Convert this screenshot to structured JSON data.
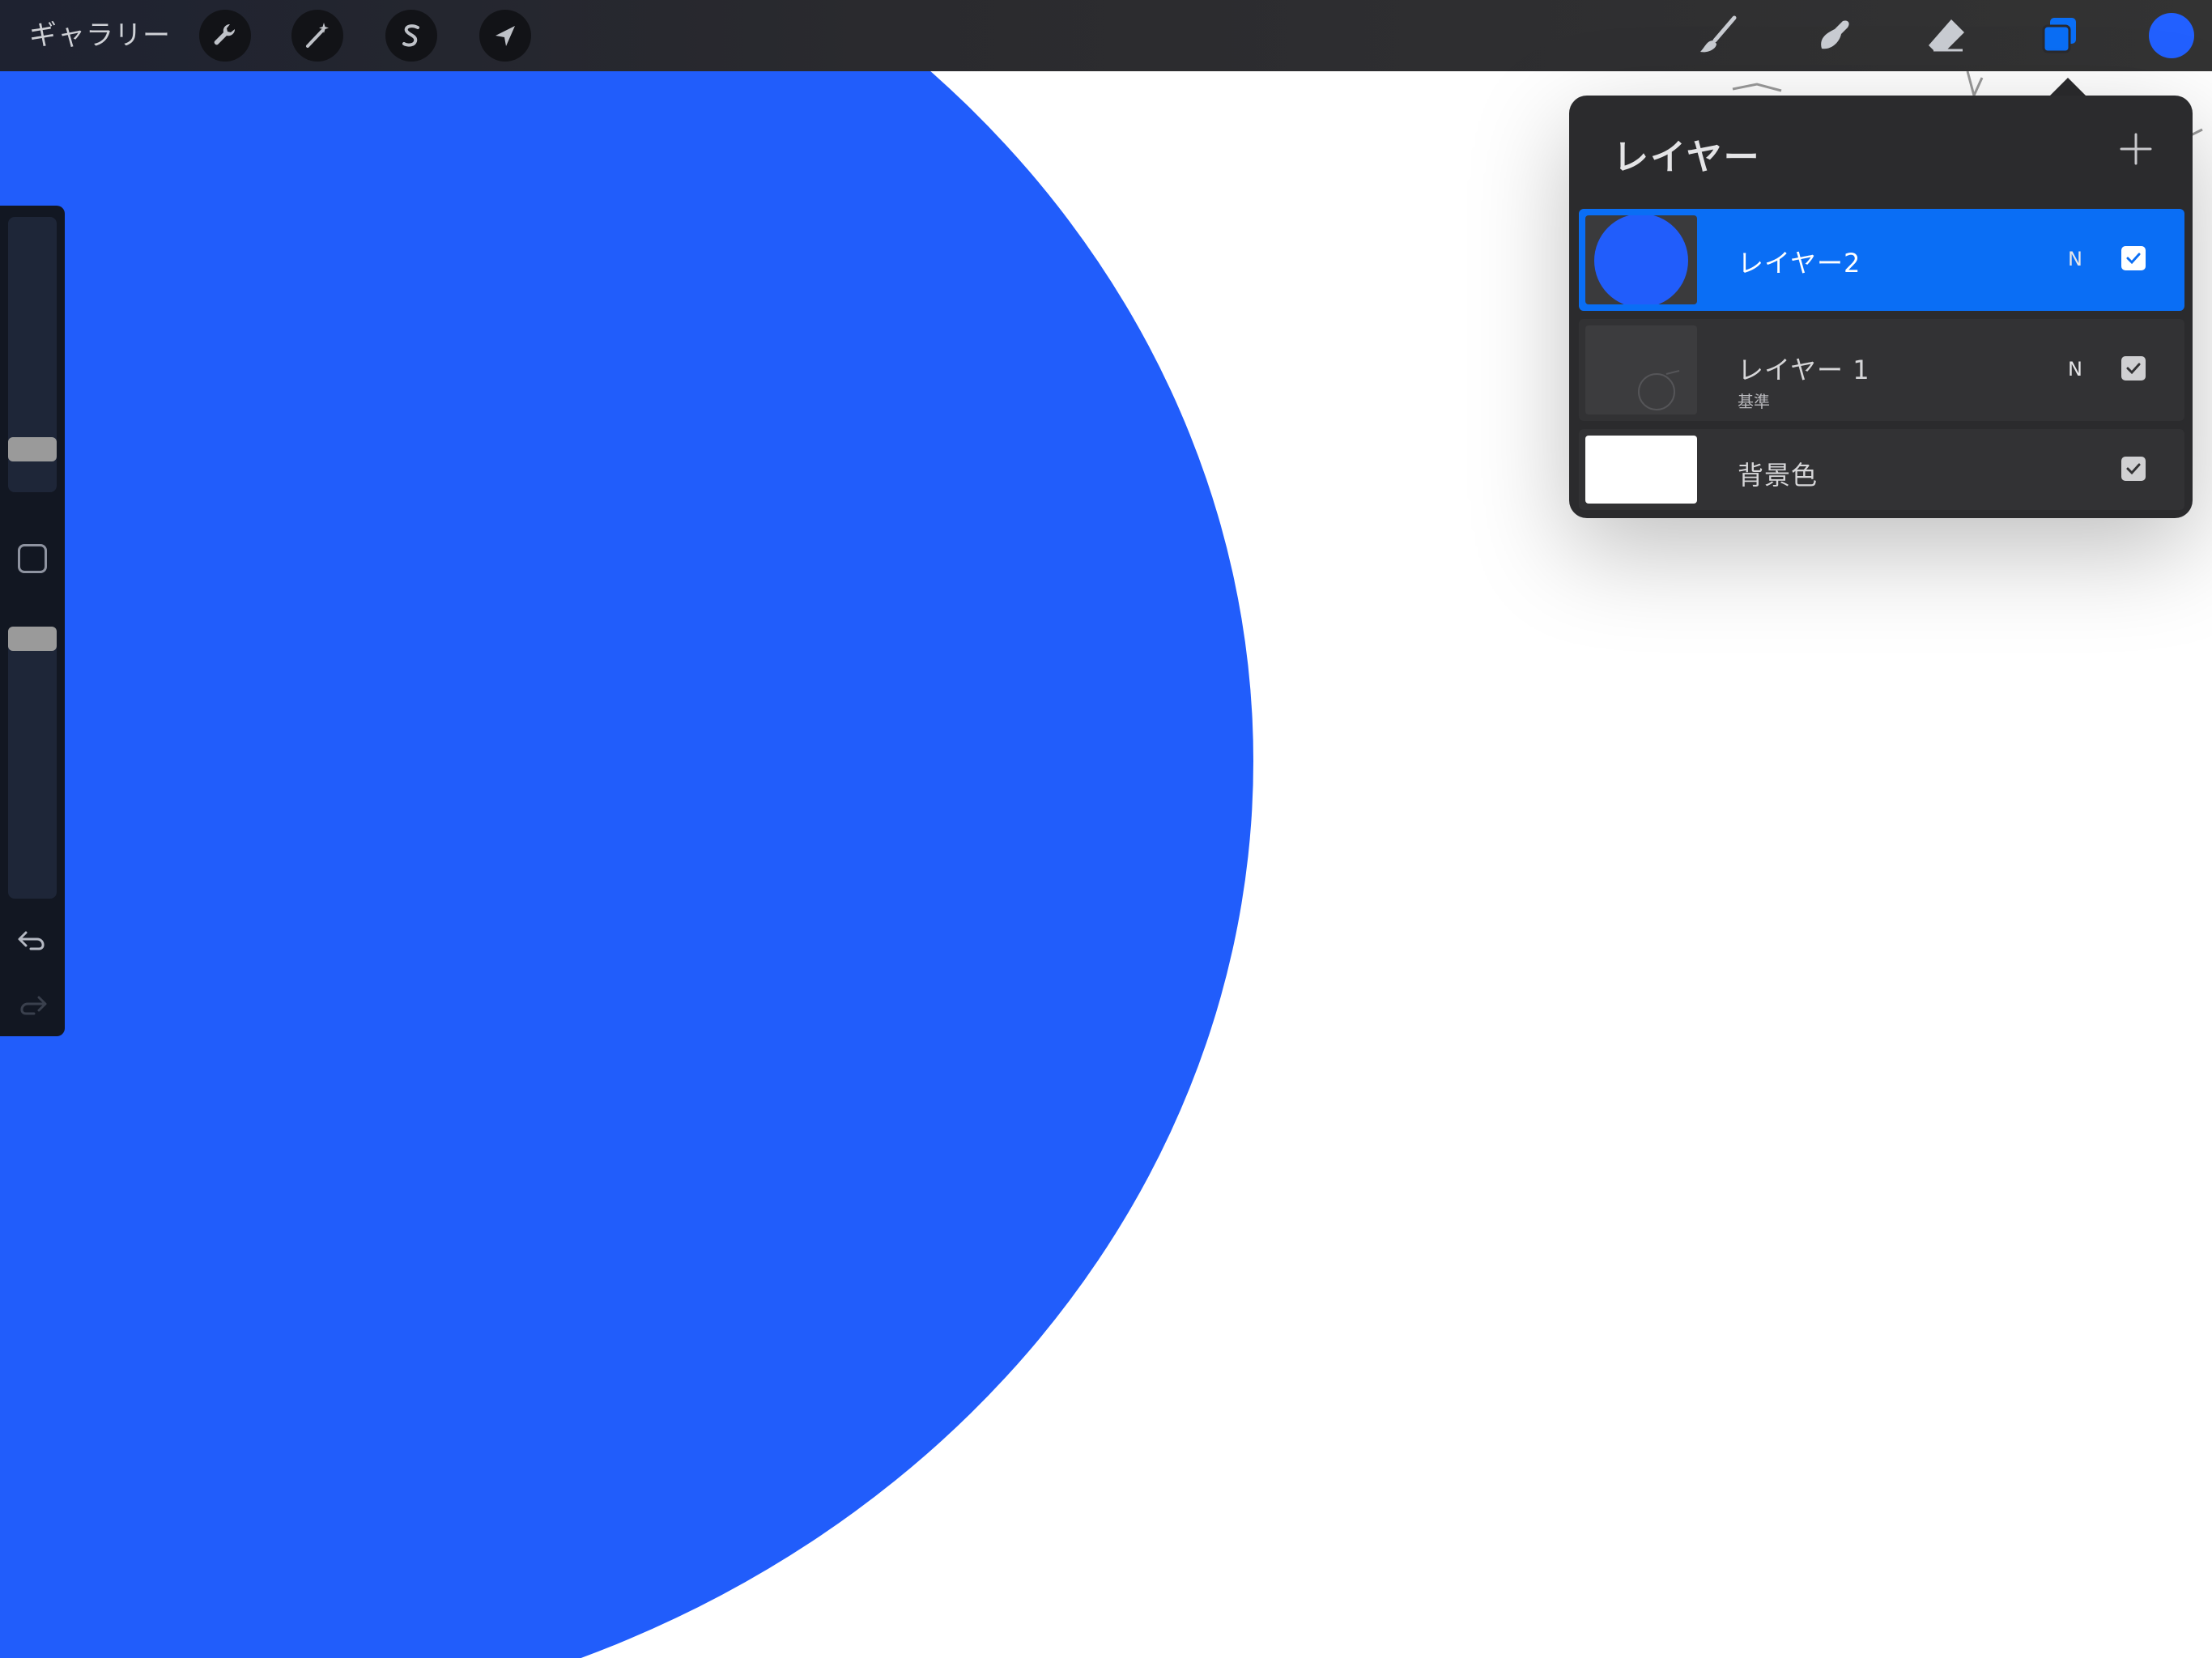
{
  "app": {
    "gallery_label": "ギャラリー"
  },
  "toolbar": {
    "left_tools": [
      {
        "name": "actions",
        "icon": "wrench-icon"
      },
      {
        "name": "adjustments",
        "icon": "magic-wand-icon"
      },
      {
        "name": "selection",
        "icon": "selection-s-icon"
      },
      {
        "name": "transform",
        "icon": "arrow-cursor-icon"
      }
    ],
    "right_tools": [
      {
        "name": "brush",
        "icon": "brush-icon"
      },
      {
        "name": "smudge",
        "icon": "smudge-icon"
      },
      {
        "name": "eraser",
        "icon": "eraser-icon"
      },
      {
        "name": "layers",
        "icon": "layers-icon",
        "active": true
      }
    ],
    "current_color": "#2260ff"
  },
  "sidebar": {
    "brush_size_level": 0.15,
    "opacity_level": 0.95,
    "undo_icon": "undo-icon",
    "redo_icon": "redo-icon"
  },
  "layers_panel": {
    "title": "レイヤー",
    "add_icon": "plus-icon",
    "layers": [
      {
        "name": "レイヤー2",
        "blend": "N",
        "visible": true,
        "selected": true,
        "subtitle": ""
      },
      {
        "name": "レイヤー 1",
        "blend": "N",
        "visible": true,
        "selected": false,
        "subtitle": "基準"
      },
      {
        "name": "背景色",
        "blend": "",
        "visible": true,
        "selected": false,
        "subtitle": ""
      }
    ]
  },
  "colors": {
    "canvas_fill": "#215dfb",
    "accent": "#0a6ef5",
    "toolbar_bg": "#2a2a2e"
  }
}
